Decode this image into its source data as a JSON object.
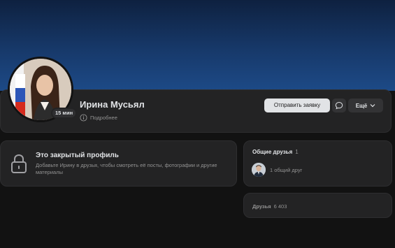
{
  "profile": {
    "name": "Ирина Мусьял",
    "online_badge": "15 мин",
    "more_info_label": "Подробнее",
    "actions": {
      "send_request": "Отправить заявку",
      "more": "Ещё"
    }
  },
  "closed_profile": {
    "title": "Это закрытый профиль",
    "description": "Добавьте Ирину в друзья, чтобы смотреть её посты, фотографии и другие материалы"
  },
  "common_friends": {
    "label": "Общие друзья",
    "count": "1",
    "summary": "1 общий друг"
  },
  "friends": {
    "label": "Друзья",
    "count": "6 403"
  },
  "colors": {
    "cover_gradient": [
      "#0e2140",
      "#1d4a87"
    ],
    "card_bg": "#232324",
    "page_bg": "#121212",
    "primary_button_bg": "#e1e3e6"
  },
  "icons": [
    "info-icon",
    "message-icon",
    "chevron-down-icon",
    "lock-icon"
  ]
}
